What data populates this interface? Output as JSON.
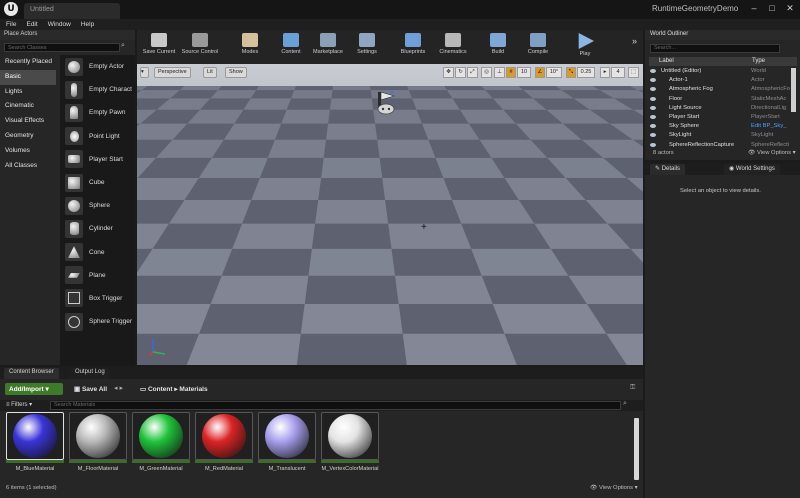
{
  "window": {
    "logo": "U",
    "doc_tab": "Untitled",
    "project": "RuntimeGeometryDemo",
    "buttons": [
      "–",
      "□",
      "✕"
    ]
  },
  "menu": [
    "File",
    "Edit",
    "Window",
    "Help"
  ],
  "place_actors": {
    "tab": "Place Actors",
    "search_placeholder": "Search Classes",
    "categories": [
      "Recently Placed",
      "Basic",
      "Lights",
      "Cinematic",
      "Visual Effects",
      "Geometry",
      "Volumes",
      "All Classes"
    ],
    "active_category": "Basic",
    "actors": [
      "Empty Actor",
      "Empty Charact",
      "Empty Pawn",
      "Point Light",
      "Player Start",
      "Cube",
      "Sphere",
      "Cylinder",
      "Cone",
      "Plane",
      "Box Trigger",
      "Sphere Trigger"
    ]
  },
  "toolbar": {
    "tools": [
      {
        "label": "Save Current",
        "icon": "save-icon",
        "color": "#c9c9c9"
      },
      {
        "label": "Source Control",
        "icon": "source-control-icon",
        "color": "#9a9a9a"
      },
      {
        "label": "Modes",
        "icon": "modes-icon",
        "color": "#d4c09a"
      },
      {
        "label": "Content",
        "icon": "content-icon",
        "color": "#6aa0d8"
      },
      {
        "label": "Marketplace",
        "icon": "marketplace-icon",
        "color": "#8c9fb8"
      },
      {
        "label": "Settings",
        "icon": "settings-icon",
        "color": "#8fa6c0"
      },
      {
        "label": "Blueprints",
        "icon": "blueprints-icon",
        "color": "#6f9fd8"
      },
      {
        "label": "Cinematics",
        "icon": "cinematics-icon",
        "color": "#b8b8b8"
      },
      {
        "label": "Build",
        "icon": "build-icon",
        "color": "#7fa7d6"
      },
      {
        "label": "Compile",
        "icon": "compile-icon",
        "color": "#7f9fc4"
      },
      {
        "label": "Play",
        "icon": "play-icon",
        "color": "#8ab6e6"
      }
    ],
    "more": "»"
  },
  "viewport": {
    "perspective": "Perspective",
    "lit": "Lit",
    "show": "Show",
    "grid_snap": "10",
    "rot_snap": "10°",
    "scale_snap": "0.25",
    "cam_speed": "4",
    "sky_color": "#c9cdd3",
    "floor_dark": "#5d6170",
    "floor_light": "#8a8e9c"
  },
  "content_browser": {
    "tabs": [
      "Content Browser",
      "Output Log"
    ],
    "add_import": "Add/Import",
    "save_all": "Save All",
    "path": [
      "Content",
      "Materials"
    ],
    "filters": "Filters",
    "search_placeholder": "Search Materials",
    "assets": [
      {
        "name": "M_BlueMaterial",
        "color": "#3b34d8",
        "selected": true
      },
      {
        "name": "M_FloorMaterial",
        "color": "#b9b9b9",
        "selected": false
      },
      {
        "name": "M_GreenMaterial",
        "color": "#20c43a",
        "selected": false
      },
      {
        "name": "M_RedMaterial",
        "color": "#dc2424",
        "selected": false
      },
      {
        "name": "M_Translucent",
        "color": "#a7a0ee",
        "selected": false
      },
      {
        "name": "M_VertexColorMaterial",
        "color": "#e4e4e4",
        "selected": false
      }
    ],
    "status": "6 items (1 selected)",
    "view_options": "View Options"
  },
  "outliner": {
    "tab": "World Outliner",
    "search_placeholder": "Search...",
    "col_label": "Label",
    "col_type": "Type",
    "rows": [
      {
        "label": "Untitled (Editor)",
        "type": "World",
        "indent": 0,
        "link": false
      },
      {
        "label": "Actor-1",
        "type": "Actor",
        "indent": 2,
        "link": false
      },
      {
        "label": "Atmospheric Fog",
        "type": "AtmosphericFo",
        "indent": 2,
        "link": false
      },
      {
        "label": "Floor",
        "type": "StaticMeshAc",
        "indent": 2,
        "link": false
      },
      {
        "label": "Light Source",
        "type": "DirectionalLig",
        "indent": 2,
        "link": false
      },
      {
        "label": "Player Start",
        "type": "PlayerStart",
        "indent": 2,
        "link": false
      },
      {
        "label": "Sky Sphere",
        "type": "Edit BP_Sky_",
        "indent": 2,
        "link": true
      },
      {
        "label": "SkyLight",
        "type": "SkyLight",
        "indent": 2,
        "link": false
      },
      {
        "label": "SphereReflectionCapture",
        "type": "SphereReflecti",
        "indent": 2,
        "link": false
      }
    ],
    "count": "8 actors",
    "view_options": "View Options"
  },
  "details": {
    "tabs": [
      "Details",
      "World Settings"
    ],
    "message": "Select an object to view details."
  }
}
